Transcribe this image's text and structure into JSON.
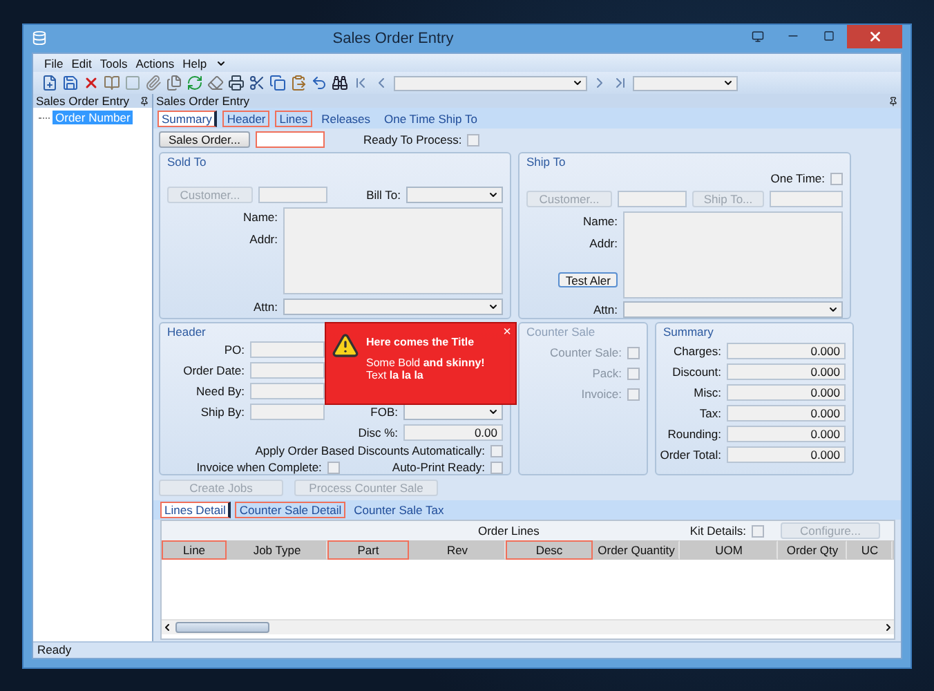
{
  "window": {
    "title": "Sales Order Entry"
  },
  "menu": [
    {
      "label": "File"
    },
    {
      "label": "Edit"
    },
    {
      "label": "Tools"
    },
    {
      "label": "Actions"
    },
    {
      "label": "Help"
    }
  ],
  "tree_panel": {
    "title": "Sales Order Entry",
    "items": [
      {
        "label": "Order Number",
        "selected": true
      }
    ]
  },
  "main_panel": {
    "title": "Sales Order Entry"
  },
  "tabs": [
    {
      "label": "Summary",
      "selected": true,
      "flagged": true
    },
    {
      "label": "Header",
      "selected": false,
      "flagged": true
    },
    {
      "label": "Lines",
      "selected": false,
      "flagged": true
    },
    {
      "label": "Releases",
      "selected": false,
      "flagged": false
    },
    {
      "label": "One Time Ship To",
      "selected": false,
      "flagged": false
    }
  ],
  "sales_order": {
    "button": "Sales Order...",
    "field_flagged": true,
    "ready_label": "Ready To Process:",
    "ready_checked": false
  },
  "sold_to": {
    "title": "Sold To",
    "customer_button": "Customer...",
    "bill_to_label": "Bill To:",
    "name_label": "Name:",
    "addr_label": "Addr:",
    "attn_label": "Attn:"
  },
  "ship_to": {
    "title": "Ship To",
    "one_time_label": "One Time:",
    "one_time_checked": false,
    "customer_button": "Customer...",
    "ship_to_button": "Ship To...",
    "name_label": "Name:",
    "addr_label": "Addr:",
    "test_button": "Test Aler",
    "attn_label": "Attn:"
  },
  "header": {
    "title": "Header",
    "fields": [
      {
        "label": "PO:"
      },
      {
        "label": "Order Date:"
      },
      {
        "label": "Need By:"
      },
      {
        "label": "Ship By:"
      }
    ],
    "fob_label": "FOB:",
    "disc_label": "Disc %:",
    "disc_value": "0.00",
    "apply_label": "Apply Order Based Discounts Automatically:",
    "apply_checked": false,
    "invoice_label": "Invoice when Complete:",
    "invoice_checked": false,
    "autoprint_label": "Auto-Print Ready:",
    "autoprint_checked": false
  },
  "counter_sale": {
    "title": "Counter Sale",
    "items": [
      {
        "label": "Counter Sale:",
        "checked": false
      },
      {
        "label": "Pack:",
        "checked": false
      },
      {
        "label": "Invoice:",
        "checked": false
      }
    ]
  },
  "summary": {
    "title": "Summary",
    "rows": [
      {
        "label": "Charges:",
        "value": "0.000"
      },
      {
        "label": "Discount:",
        "value": "0.000"
      },
      {
        "label": "Misc:",
        "value": "0.000"
      },
      {
        "label": "Tax:",
        "value": "0.000"
      },
      {
        "label": "Rounding:",
        "value": "0.000"
      },
      {
        "label": "Order Total:",
        "value": "0.000"
      }
    ]
  },
  "actions": [
    {
      "label": "Create Jobs",
      "disabled": true
    },
    {
      "label": "Process Counter Sale",
      "disabled": true
    }
  ],
  "lines_tabs": [
    {
      "label": "Lines Detail",
      "selected": true,
      "flagged": true
    },
    {
      "label": "Counter Sale Detail",
      "selected": false,
      "flagged": true
    },
    {
      "label": "Counter Sale Tax",
      "selected": false,
      "flagged": false
    }
  ],
  "grid": {
    "title": "Order Lines",
    "kit_label": "Kit Details:",
    "kit_checked": false,
    "configure_button": "Configure...",
    "columns": [
      {
        "label": "Line",
        "flagged": true
      },
      {
        "label": "Job Type",
        "flagged": false
      },
      {
        "label": "Part",
        "flagged": true
      },
      {
        "label": "Rev",
        "flagged": false
      },
      {
        "label": "Desc",
        "flagged": true
      },
      {
        "label": "Order Quantity",
        "flagged": false
      },
      {
        "label": "UOM",
        "flagged": false
      },
      {
        "label": "Order Qty",
        "flagged": false
      },
      {
        "label": "UC",
        "flagged": false
      }
    ]
  },
  "toast": {
    "title": "Here comes the Title",
    "lines": [
      "Some Bold **and skinny!**",
      "Text **la la la**"
    ],
    "close": "×"
  },
  "status_bar": {
    "text": "Ready"
  }
}
